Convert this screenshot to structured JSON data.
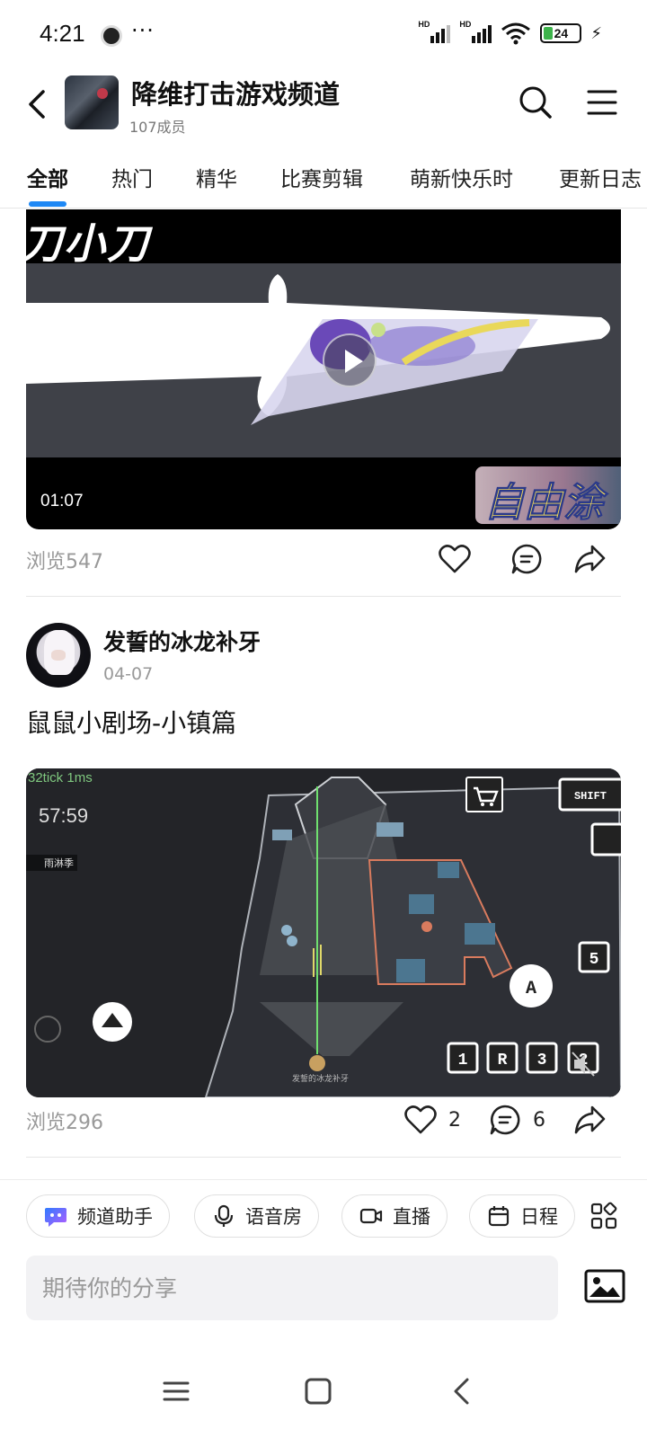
{
  "status_bar": {
    "time": "4:21",
    "more": "···",
    "sim1_label": "HD",
    "sim2_label": "HD",
    "battery": "24"
  },
  "header": {
    "title": "降维打击游戏频道",
    "members": "107成员"
  },
  "tabs": [
    {
      "label": "全部",
      "active": true
    },
    {
      "label": "热门"
    },
    {
      "label": "精华"
    },
    {
      "label": "比赛剪辑"
    },
    {
      "label": "萌新快乐时"
    },
    {
      "label": "更新日志"
    }
  ],
  "posts": [
    {
      "video_overlay_text": "刀小刀",
      "corner_text": "自由涂",
      "duration": "01:07",
      "views": "浏览547",
      "likes": "",
      "comments": ""
    },
    {
      "author": "发誓的冰龙补牙",
      "date": "04-07",
      "title": "鼠鼠小剧场-小镇篇",
      "video_tick": "32tick 1ms",
      "video_time": "57:59",
      "video_tag": "雨淋季",
      "video_watermark": "发誓的冰龙补牙",
      "keys": [
        "SHIFT",
        "5",
        "1",
        "R",
        "3",
        "2",
        "A"
      ],
      "views": "浏览296",
      "likes": "2",
      "comments": "6"
    }
  ],
  "toolbar": {
    "chips": [
      {
        "label": "频道助手",
        "icon": "assistant-icon"
      },
      {
        "label": "语音房",
        "icon": "microphone-icon"
      },
      {
        "label": "直播",
        "icon": "live-camera-icon"
      },
      {
        "label": "日程",
        "icon": "calendar-icon"
      }
    ],
    "input_placeholder": "期待你的分享"
  },
  "colors": {
    "accent": "#1e88f5",
    "battery_fill": "#3db34b"
  }
}
